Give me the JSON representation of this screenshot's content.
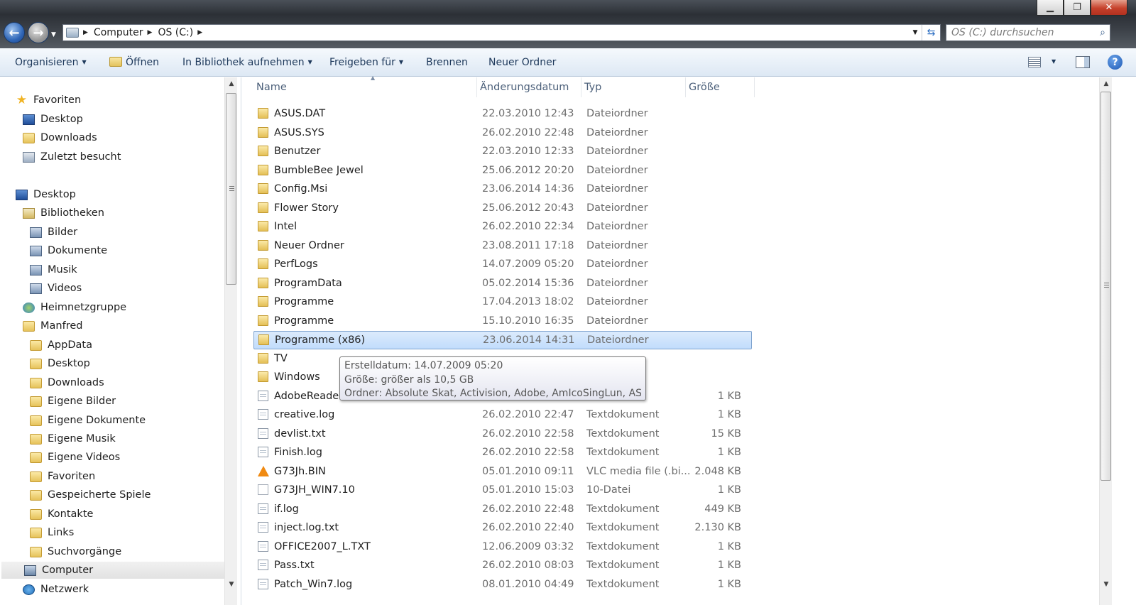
{
  "window": {
    "minimize": "▁",
    "maximize": "❐",
    "close": "✕"
  },
  "address": {
    "segments": [
      "Computer",
      "OS (C:)"
    ],
    "search_placeholder": "OS (C:) durchsuchen"
  },
  "toolbar": {
    "organize": "Organisieren",
    "open": "Öffnen",
    "library": "In Bibliothek aufnehmen",
    "share": "Freigeben für",
    "burn": "Brennen",
    "new_folder": "Neuer Ordner"
  },
  "navpane": {
    "items": [
      {
        "label": "Favoriten",
        "icon": "star-icon"
      },
      {
        "label": "Desktop",
        "icon": "desktop-icon"
      },
      {
        "label": "Downloads",
        "icon": "folder-icon"
      },
      {
        "label": "Zuletzt besucht",
        "icon": "recent-places-icon"
      },
      {
        "label": "Desktop",
        "icon": "desktop-icon"
      },
      {
        "label": "Bibliotheken",
        "icon": "library-icon"
      },
      {
        "label": "Bilder",
        "icon": "pictures-library-icon"
      },
      {
        "label": "Dokumente",
        "icon": "documents-library-icon"
      },
      {
        "label": "Musik",
        "icon": "music-library-icon"
      },
      {
        "label": "Videos",
        "icon": "videos-library-icon"
      },
      {
        "label": "Heimnetzgruppe",
        "icon": "homegroup-icon"
      },
      {
        "label": "Manfred",
        "icon": "user-folder-icon"
      },
      {
        "label": "AppData",
        "icon": "folder-icon"
      },
      {
        "label": "Desktop",
        "icon": "folder-icon"
      },
      {
        "label": "Downloads",
        "icon": "folder-icon"
      },
      {
        "label": "Eigene Bilder",
        "icon": "folder-icon"
      },
      {
        "label": "Eigene Dokumente",
        "icon": "folder-icon"
      },
      {
        "label": "Eigene Musik",
        "icon": "folder-icon"
      },
      {
        "label": "Eigene Videos",
        "icon": "folder-icon"
      },
      {
        "label": "Favoriten",
        "icon": "folder-icon"
      },
      {
        "label": "Gespeicherte Spiele",
        "icon": "folder-icon"
      },
      {
        "label": "Kontakte",
        "icon": "folder-icon"
      },
      {
        "label": "Links",
        "icon": "folder-icon"
      },
      {
        "label": "Suchvorgänge",
        "icon": "folder-icon"
      },
      {
        "label": "Computer",
        "icon": "computer-icon"
      },
      {
        "label": "Netzwerk",
        "icon": "network-icon"
      }
    ]
  },
  "columns": {
    "name": "Name",
    "date": "Änderungsdatum",
    "type": "Typ",
    "size": "Größe"
  },
  "files": [
    {
      "name": "ASUS.DAT",
      "date": "22.03.2010 12:43",
      "type": "Dateiordner",
      "size": "",
      "icon": "folder-icon"
    },
    {
      "name": "ASUS.SYS",
      "date": "26.02.2010 22:48",
      "type": "Dateiordner",
      "size": "",
      "icon": "folder-icon"
    },
    {
      "name": "Benutzer",
      "date": "22.03.2010 12:33",
      "type": "Dateiordner",
      "size": "",
      "icon": "folder-icon"
    },
    {
      "name": "BumbleBee Jewel",
      "date": "25.06.2012 20:20",
      "type": "Dateiordner",
      "size": "",
      "icon": "folder-icon"
    },
    {
      "name": "Config.Msi",
      "date": "23.06.2014 14:36",
      "type": "Dateiordner",
      "size": "",
      "icon": "folder-icon"
    },
    {
      "name": "Flower Story",
      "date": "25.06.2012 20:43",
      "type": "Dateiordner",
      "size": "",
      "icon": "folder-icon"
    },
    {
      "name": "Intel",
      "date": "26.02.2010 22:34",
      "type": "Dateiordner",
      "size": "",
      "icon": "folder-icon"
    },
    {
      "name": "Neuer Ordner",
      "date": "23.08.2011 17:18",
      "type": "Dateiordner",
      "size": "",
      "icon": "folder-icon"
    },
    {
      "name": "PerfLogs",
      "date": "14.07.2009 05:20",
      "type": "Dateiordner",
      "size": "",
      "icon": "folder-icon"
    },
    {
      "name": "ProgramData",
      "date": "05.02.2014 15:36",
      "type": "Dateiordner",
      "size": "",
      "icon": "folder-icon"
    },
    {
      "name": "Programme",
      "date": "17.04.2013 18:02",
      "type": "Dateiordner",
      "size": "",
      "icon": "folder-icon"
    },
    {
      "name": "Programme",
      "date": "15.10.2010 16:35",
      "type": "Dateiordner",
      "size": "",
      "icon": "folder-icon"
    },
    {
      "name": "Programme (x86)",
      "date": "23.06.2014 14:31",
      "type": "Dateiordner",
      "size": "",
      "icon": "folder-icon"
    },
    {
      "name": "TV",
      "date": "",
      "type": "",
      "size": "",
      "icon": "folder-icon"
    },
    {
      "name": "Windows",
      "date": "",
      "type": "",
      "size": "",
      "icon": "folder-icon"
    },
    {
      "name": "AdobeReader",
      "date": "",
      "type": "",
      "size": "1 KB",
      "icon": "text-document-icon"
    },
    {
      "name": "creative.log",
      "date": "26.02.2010 22:47",
      "type": "Textdokument",
      "size": "1 KB",
      "icon": "text-document-icon"
    },
    {
      "name": "devlist.txt",
      "date": "26.02.2010 22:58",
      "type": "Textdokument",
      "size": "15 KB",
      "icon": "text-document-icon"
    },
    {
      "name": "Finish.log",
      "date": "26.02.2010 22:58",
      "type": "Textdokument",
      "size": "1 KB",
      "icon": "text-document-icon"
    },
    {
      "name": "G73Jh.BIN",
      "date": "05.01.2010 09:11",
      "type": "VLC media file (.bi...",
      "size": "2.048 KB",
      "icon": "vlc-cone-icon"
    },
    {
      "name": "G73JH_WIN7.10",
      "date": "05.01.2010 15:03",
      "type": "10-Datei",
      "size": "1 KB",
      "icon": "file-icon"
    },
    {
      "name": "if.log",
      "date": "26.02.2010 22:48",
      "type": "Textdokument",
      "size": "449 KB",
      "icon": "text-document-icon"
    },
    {
      "name": "inject.log.txt",
      "date": "26.02.2010 22:40",
      "type": "Textdokument",
      "size": "2.130 KB",
      "icon": "text-document-icon"
    },
    {
      "name": "OFFICE2007_L.TXT",
      "date": "12.06.2009 03:32",
      "type": "Textdokument",
      "size": "1 KB",
      "icon": "text-document-icon"
    },
    {
      "name": "Pass.txt",
      "date": "26.02.2010 08:03",
      "type": "Textdokument",
      "size": "1 KB",
      "icon": "text-document-icon"
    },
    {
      "name": "Patch_Win7.log",
      "date": "08.01.2010 04:49",
      "type": "Textdokument",
      "size": "1 KB",
      "icon": "text-document-icon"
    }
  ],
  "tooltip": {
    "line1": "Erstelldatum: 14.07.2009 05:20",
    "line2": "Größe: größer als 10,5 GB",
    "line3": "Ordner: Absolute Skat, Activision, Adobe, AmIcoSingLun, ASUS, ..."
  }
}
